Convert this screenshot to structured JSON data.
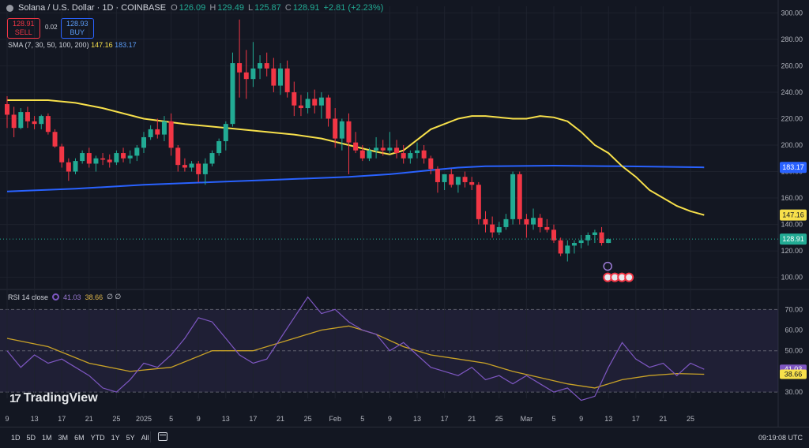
{
  "header": {
    "symbol": "Solana / U.S. Dollar · 1D · COINBASE",
    "open_label": "O",
    "open": "126.09",
    "high_label": "H",
    "high": "129.49",
    "low_label": "L",
    "low": "125.87",
    "close_label": "C",
    "close": "128.91",
    "change": "+2.81 (+2.23%)"
  },
  "trade": {
    "sell_price": "128.91",
    "sell_label": "SELL",
    "buy_price": "128.93",
    "buy_label": "BUY",
    "spread": "0.02"
  },
  "sma_legend": {
    "label": "SMA (7, 30, 50, 100, 200)",
    "value1": "147.16",
    "value2": "183.17"
  },
  "rsi_legend": {
    "label": "RSI 14 close",
    "value1": "41.03",
    "value2": "38.66",
    "extra": "∅ ∅"
  },
  "branding": {
    "logo": "TradingView"
  },
  "bottom_bar": {
    "timeframes": [
      "1D",
      "5D",
      "1M",
      "3M",
      "6M",
      "YTD",
      "1Y",
      "5Y",
      "All"
    ],
    "clock": "09:19:08 UTC"
  },
  "colors": {
    "up": "#22ab94",
    "down": "#f23645",
    "sma_fast": "#f7e04b",
    "sma_slow": "#2962ff",
    "rsi": "#7e57c2",
    "rsi_ma": "#c9a227"
  },
  "chart_data": [
    {
      "type": "candlestick",
      "title": "Solana / U.S. Dollar · 1D · COINBASE",
      "ylim": [
        95,
        305
      ],
      "y_ticks": [
        100,
        120,
        140,
        160,
        180,
        200,
        220,
        240,
        260,
        280,
        300
      ],
      "x_ticks": [
        "9",
        "13",
        "17",
        "21",
        "25",
        "2025",
        "5",
        "9",
        "13",
        "17",
        "21",
        "25",
        "Feb",
        "5",
        "9",
        "13",
        "17",
        "21",
        "25",
        "Mar",
        "5",
        "9",
        "13",
        "17",
        "21",
        "25"
      ],
      "price_labels": {
        "sma_fast": "147.16",
        "sma_slow": "183.17",
        "last": "128.91"
      },
      "candles": [
        [
          231,
          237,
          213,
          223
        ],
        [
          223,
          229,
          206,
          213
        ],
        [
          213,
          228,
          212,
          225
        ],
        [
          225,
          229,
          213,
          218
        ],
        [
          218,
          222,
          212,
          216
        ],
        [
          216,
          223,
          212,
          222
        ],
        [
          222,
          224,
          208,
          210
        ],
        [
          210,
          212,
          198,
          199
        ],
        [
          199,
          201,
          183,
          187
        ],
        [
          187,
          190,
          173,
          180
        ],
        [
          180,
          190,
          178,
          188
        ],
        [
          188,
          196,
          186,
          194
        ],
        [
          194,
          198,
          183,
          186
        ],
        [
          186,
          192,
          180,
          190
        ],
        [
          190,
          194,
          185,
          189
        ],
        [
          189,
          193,
          183,
          187
        ],
        [
          187,
          196,
          185,
          194
        ],
        [
          194,
          198,
          187,
          190
        ],
        [
          190,
          196,
          186,
          192
        ],
        [
          192,
          200,
          188,
          198
        ],
        [
          198,
          210,
          194,
          206
        ],
        [
          206,
          215,
          204,
          212
        ],
        [
          212,
          220,
          205,
          208
        ],
        [
          208,
          222,
          203,
          218
        ],
        [
          218,
          224,
          192,
          198
        ],
        [
          198,
          200,
          180,
          185
        ],
        [
          185,
          190,
          180,
          183
        ],
        [
          183,
          188,
          180,
          186
        ],
        [
          186,
          188,
          172,
          178
        ],
        [
          178,
          190,
          170,
          186
        ],
        [
          186,
          196,
          184,
          194
        ],
        [
          194,
          205,
          192,
          203
        ],
        [
          203,
          218,
          196,
          216
        ],
        [
          216,
          270,
          214,
          262
        ],
        [
          262,
          295,
          236,
          255
        ],
        [
          255,
          272,
          235,
          250
        ],
        [
          250,
          278,
          244,
          258
        ],
        [
          258,
          268,
          250,
          262
        ],
        [
          262,
          270,
          252,
          258
        ],
        [
          258,
          266,
          240,
          245
        ],
        [
          245,
          262,
          238,
          258
        ],
        [
          258,
          264,
          236,
          240
        ],
        [
          240,
          248,
          222,
          230
        ],
        [
          230,
          238,
          222,
          228
        ],
        [
          228,
          240,
          224,
          235
        ],
        [
          235,
          242,
          224,
          230
        ],
        [
          230,
          240,
          220,
          236
        ],
        [
          236,
          238,
          214,
          220
        ],
        [
          220,
          228,
          198,
          205
        ],
        [
          205,
          220,
          196,
          218
        ],
        [
          218,
          224,
          178,
          202
        ],
        [
          202,
          210,
          194,
          196
        ],
        [
          196,
          200,
          188,
          190
        ],
        [
          190,
          198,
          188,
          196
        ],
        [
          196,
          206,
          190,
          198
        ],
        [
          198,
          204,
          192,
          196
        ],
        [
          196,
          210,
          194,
          198
        ],
        [
          198,
          204,
          190,
          194
        ],
        [
          194,
          200,
          186,
          190
        ],
        [
          190,
          196,
          186,
          194
        ],
        [
          194,
          202,
          190,
          196
        ],
        [
          196,
          200,
          186,
          190
        ],
        [
          190,
          192,
          178,
          182
        ],
        [
          182,
          184,
          164,
          172
        ],
        [
          172,
          178,
          166,
          178
        ],
        [
          178,
          182,
          168,
          170
        ],
        [
          170,
          176,
          164,
          176
        ],
        [
          176,
          180,
          168,
          172
        ],
        [
          172,
          176,
          166,
          170
        ],
        [
          170,
          172,
          140,
          144
        ],
        [
          144,
          150,
          134,
          140
        ],
        [
          140,
          146,
          130,
          134
        ],
        [
          134,
          142,
          132,
          138
        ],
        [
          138,
          148,
          136,
          144
        ],
        [
          144,
          180,
          140,
          178
        ],
        [
          178,
          180,
          140,
          144
        ],
        [
          144,
          148,
          130,
          140
        ],
        [
          140,
          152,
          136,
          145
        ],
        [
          145,
          148,
          134,
          138
        ],
        [
          138,
          144,
          134,
          136
        ],
        [
          136,
          140,
          126,
          128
        ],
        [
          128,
          130,
          116,
          118
        ],
        [
          118,
          128,
          112,
          124
        ],
        [
          124,
          128,
          118,
          126
        ],
        [
          126,
          132,
          122,
          128
        ],
        [
          128,
          134,
          124,
          132
        ],
        [
          132,
          136,
          126,
          134
        ],
        [
          134,
          138,
          124,
          126
        ],
        [
          126,
          129.49,
          125.87,
          128.91
        ]
      ],
      "sma_fast_values": [
        [
          0,
          234
        ],
        [
          6,
          234
        ],
        [
          10,
          232
        ],
        [
          14,
          228
        ],
        [
          20,
          220
        ],
        [
          26,
          216
        ],
        [
          30,
          214
        ],
        [
          34,
          212
        ],
        [
          38,
          210
        ],
        [
          42,
          208
        ],
        [
          46,
          205
        ],
        [
          50,
          200
        ],
        [
          54,
          195
        ],
        [
          56,
          193
        ],
        [
          58,
          196
        ],
        [
          60,
          204
        ],
        [
          62,
          212
        ],
        [
          64,
          216
        ],
        [
          66,
          220
        ],
        [
          68,
          222
        ],
        [
          70,
          222
        ],
        [
          72,
          221
        ],
        [
          74,
          220
        ],
        [
          76,
          220
        ],
        [
          78,
          222
        ],
        [
          80,
          221
        ],
        [
          82,
          218
        ],
        [
          84,
          210
        ],
        [
          86,
          200
        ],
        [
          88,
          194
        ],
        [
          90,
          184
        ],
        [
          92,
          176
        ],
        [
          94,
          166
        ],
        [
          96,
          160
        ],
        [
          98,
          154
        ],
        [
          100,
          150
        ],
        [
          102,
          147.16
        ]
      ],
      "sma_slow_values": [
        [
          0,
          165
        ],
        [
          10,
          167
        ],
        [
          20,
          170
        ],
        [
          30,
          172
        ],
        [
          40,
          174
        ],
        [
          50,
          176
        ],
        [
          56,
          178
        ],
        [
          62,
          181
        ],
        [
          66,
          183
        ],
        [
          70,
          184
        ],
        [
          80,
          184.5
        ],
        [
          90,
          184
        ],
        [
          102,
          183.17
        ]
      ]
    },
    {
      "type": "line",
      "title": "RSI 14 close",
      "ylim": [
        27,
        77
      ],
      "y_ticks": [
        30,
        40,
        50,
        60,
        70
      ],
      "bands": [
        30,
        50,
        70
      ],
      "series": [
        {
          "name": "RSI",
          "values": [
            [
              0,
              50
            ],
            [
              2,
              42
            ],
            [
              4,
              48
            ],
            [
              6,
              44
            ],
            [
              8,
              46
            ],
            [
              10,
              42
            ],
            [
              12,
              38
            ],
            [
              14,
              32
            ],
            [
              16,
              30
            ],
            [
              18,
              36
            ],
            [
              20,
              44
            ],
            [
              22,
              42
            ],
            [
              24,
              48
            ],
            [
              26,
              56
            ],
            [
              28,
              66
            ],
            [
              30,
              64
            ],
            [
              32,
              56
            ],
            [
              34,
              48
            ],
            [
              36,
              44
            ],
            [
              38,
              46
            ],
            [
              40,
              56
            ],
            [
              42,
              66
            ],
            [
              44,
              76
            ],
            [
              46,
              68
            ],
            [
              48,
              70
            ],
            [
              50,
              64
            ],
            [
              52,
              60
            ],
            [
              54,
              58
            ],
            [
              56,
              50
            ],
            [
              58,
              54
            ],
            [
              60,
              48
            ],
            [
              62,
              42
            ],
            [
              64,
              40
            ],
            [
              66,
              38
            ],
            [
              68,
              42
            ],
            [
              70,
              36
            ],
            [
              72,
              38
            ],
            [
              74,
              34
            ],
            [
              76,
              38
            ],
            [
              78,
              34
            ],
            [
              80,
              30
            ],
            [
              82,
              32
            ],
            [
              84,
              26
            ],
            [
              86,
              28
            ],
            [
              88,
              42
            ],
            [
              90,
              54
            ],
            [
              92,
              46
            ],
            [
              94,
              42
            ],
            [
              96,
              44
            ],
            [
              98,
              38
            ],
            [
              100,
              44
            ],
            [
              102,
              41.03
            ]
          ]
        },
        {
          "name": "RSI MA",
          "values": [
            [
              0,
              56
            ],
            [
              6,
              52
            ],
            [
              12,
              44
            ],
            [
              18,
              40
            ],
            [
              24,
              42
            ],
            [
              30,
              50
            ],
            [
              36,
              50
            ],
            [
              42,
              56
            ],
            [
              46,
              60
            ],
            [
              50,
              62
            ],
            [
              54,
              58
            ],
            [
              58,
              52
            ],
            [
              62,
              48
            ],
            [
              66,
              46
            ],
            [
              70,
              44
            ],
            [
              74,
              40
            ],
            [
              78,
              37
            ],
            [
              82,
              34
            ],
            [
              86,
              32
            ],
            [
              90,
              36
            ],
            [
              94,
              38
            ],
            [
              98,
              39
            ],
            [
              102,
              38.66
            ]
          ]
        }
      ]
    }
  ]
}
